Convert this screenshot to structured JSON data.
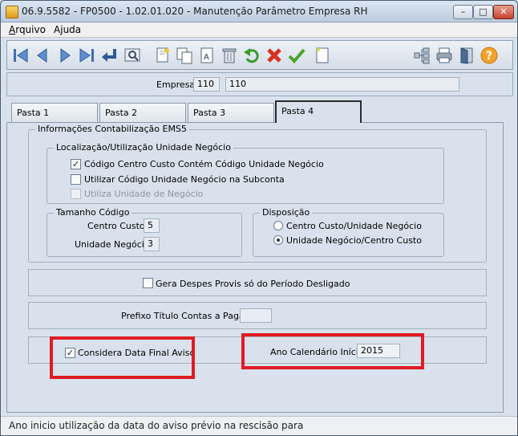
{
  "window": {
    "title": "06.9.5582 - FP0500 - 1.02.01.020 - Manutenção Parâmetro Empresa RH",
    "min_glyph": "–",
    "max_glyph": "□",
    "close_glyph": "✕"
  },
  "menu": {
    "items": [
      "Arquivo",
      "Ajuda"
    ]
  },
  "toolbar": {
    "buttons": [
      "first-record-icon",
      "previous-record-icon",
      "next-record-icon",
      "last-record-icon",
      "goto-record-icon",
      "search-icon",
      "new-record-icon",
      "copy-record-icon",
      "edit-text-icon",
      "delete-icon",
      "undo-icon",
      "cancel-icon",
      "confirm-icon",
      "blank-document-icon",
      "tree-icon",
      "print-icon",
      "exit-icon",
      "help-icon"
    ]
  },
  "empresa": {
    "label": "Empresa:",
    "code": "110",
    "name": "110"
  },
  "tabs": [
    "Pasta 1",
    "Pasta 2",
    "Pasta 3",
    "Pasta 4"
  ],
  "active_tab": "Pasta 4",
  "ems5": {
    "title": "Informações Contabilização EMS5",
    "localizacao": {
      "title": "Localização/Utilização Unidade Negócio",
      "options": [
        {
          "label": "Código Centro Custo Contém Código Unidade Negócio",
          "checked": true,
          "enabled": true
        },
        {
          "label": "Utilizar Código Unidade Negócio na Subconta",
          "checked": false,
          "enabled": true
        },
        {
          "label": "Utiliza Unidade de Negócio",
          "checked": false,
          "enabled": false
        }
      ]
    },
    "tamanho": {
      "title": "Tamanho Código",
      "centro_custo_label": "Centro Custo:",
      "centro_custo_value": "5",
      "unidade_negocio_label": "Unidade Negócio:",
      "unidade_negocio_value": "3"
    },
    "disposicao": {
      "title": "Disposição",
      "options": [
        {
          "label": "Centro Custo/Unidade Negócio",
          "selected": false
        },
        {
          "label": "Unidade Negócio/Centro Custo",
          "selected": true
        }
      ]
    }
  },
  "gera_despes": {
    "label": "Gera Despes Provis só do Período Desligado",
    "checked": false
  },
  "prefixo": {
    "label": "Prefixo Título Contas a Pagar:",
    "value": ""
  },
  "considera": {
    "label": "Considera Data Final Aviso",
    "checked": true
  },
  "ano_calendario": {
    "label": "Ano Calendário Início:",
    "value": "2015"
  },
  "check_glyph": "✓",
  "colors": {
    "highlight": "#e01b24",
    "panel": "#d9e2ec"
  },
  "status": "Ano inicio utilização da data do aviso prévio na rescisão para"
}
